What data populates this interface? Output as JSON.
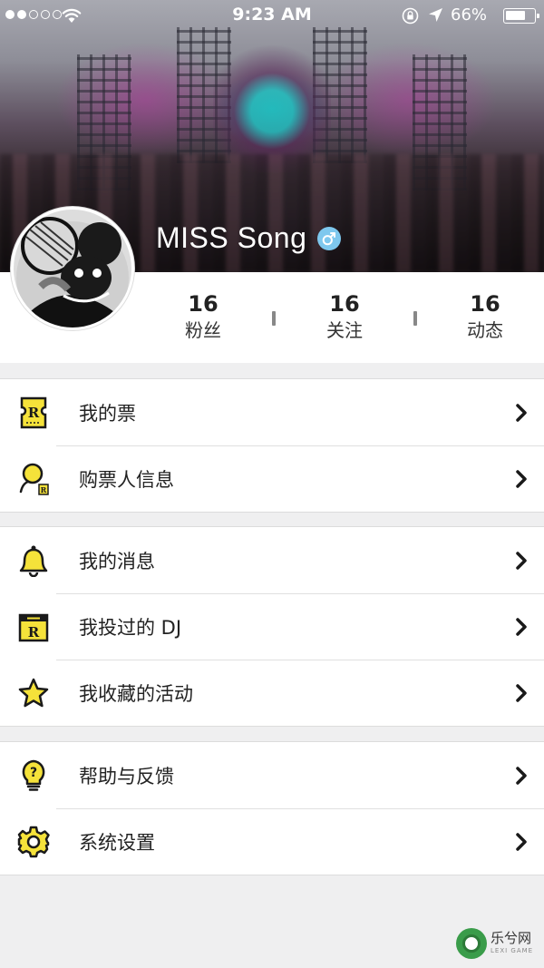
{
  "status_bar": {
    "time": "9:23 AM",
    "battery_percent": "66%",
    "battery_level": 0.66,
    "signal_bars_filled": 2,
    "signal_bars_total": 5
  },
  "profile": {
    "name": "MISS Song",
    "gender_icon": "male-symbol-icon",
    "stats": [
      {
        "value": "16",
        "label": "粉丝"
      },
      {
        "value": "16",
        "label": "关注"
      },
      {
        "value": "16",
        "label": "动态"
      }
    ]
  },
  "menu": {
    "groups": [
      {
        "items": [
          {
            "label": "我的票",
            "icon": "ticket-icon"
          },
          {
            "label": "购票人信息",
            "icon": "buyer-info-icon"
          }
        ]
      },
      {
        "items": [
          {
            "label": "我的消息",
            "icon": "bell-icon"
          },
          {
            "label": "我投过的 DJ",
            "icon": "ballot-box-icon"
          },
          {
            "label": "我收藏的活动",
            "icon": "star-icon"
          }
        ]
      },
      {
        "items": [
          {
            "label": "帮助与反馈",
            "icon": "help-bulb-icon"
          },
          {
            "label": "系统设置",
            "icon": "settings-gear-icon"
          }
        ]
      }
    ]
  },
  "colors": {
    "accent_yellow": "#f5e23a",
    "icon_outline": "#1a1a1a",
    "gender_badge": "#7ec8ee",
    "background": "#efeff0"
  },
  "watermark": {
    "text": "乐兮网",
    "sub": "LEXI GAME"
  }
}
